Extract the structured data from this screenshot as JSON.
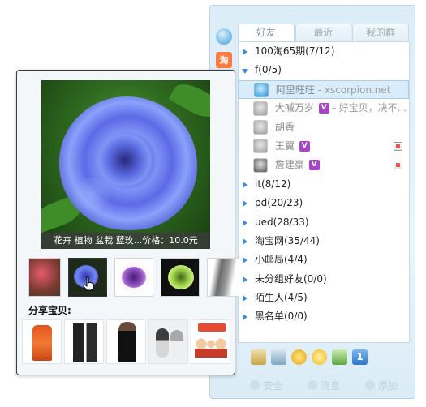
{
  "friend_panel": {
    "tabs": [
      "好友",
      "最近",
      "我的群"
    ],
    "groups": [
      {
        "label": "100淘65期(7/12)",
        "expanded": false
      },
      {
        "label": "f(0/5)",
        "expanded": true
      }
    ],
    "friends": [
      {
        "name": "阿里旺旺",
        "signature": "- xscorpion.net",
        "selected": true
      },
      {
        "name": "大喊万岁",
        "badge": "V",
        "signature": "- 好宝贝，决不..."
      },
      {
        "name": "胡香"
      },
      {
        "name": "王翼",
        "badge": "V"
      },
      {
        "name": "詹建豪",
        "badge": "V"
      }
    ],
    "more_groups": [
      "it(8/12)",
      "pd(20/23)",
      "ued(28/33)",
      "淘宝网(35/44)",
      "小邮局(4/4)",
      "未分组好友(0/0)",
      "陌生人(4/5)",
      "黑名单(0/0)"
    ],
    "side_icons": [
      "smile-icon",
      "tao-icon"
    ],
    "tao_glyph": "淘",
    "bottom_icons": [
      "shop-icon",
      "contacts-icon",
      "weather-icon",
      "sun-icon",
      "game-icon",
      "info-icon"
    ],
    "info_glyph": "1",
    "status": {
      "security": "安全",
      "message": "消息",
      "add": "添加"
    }
  },
  "popup": {
    "caption": "花卉 植物 盆栽 蓝玫...价格：10.0元",
    "share_label": "分享宝贝:",
    "thumbnails": [
      "pink-flowers",
      "blue-rose",
      "purple-rose",
      "green-rose",
      "gray-scarf"
    ],
    "shares": [
      "orange-coat",
      "black-pants",
      "black-dress",
      "cat-figurines",
      "doll-figures"
    ]
  },
  "colors": {
    "accent": "#3f8bd6",
    "vip_badge": "#a744c9",
    "selected_row": "#d9ecfa"
  }
}
